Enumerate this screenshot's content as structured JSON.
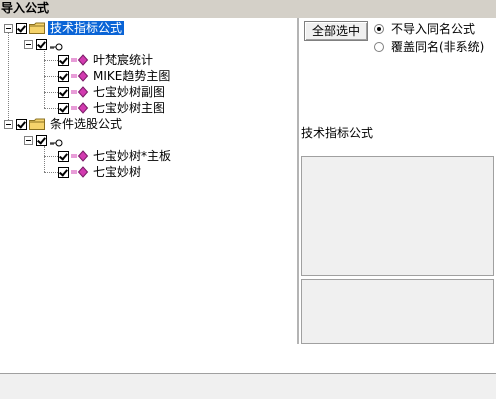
{
  "window": {
    "title": "导入公式"
  },
  "tree": {
    "nodes": [
      {
        "label": "技术指标公式",
        "checked": true,
        "selected": true,
        "icon": "folder-icon"
      },
      {
        "label": "",
        "checked": true,
        "icon": "key-icon"
      },
      {
        "label": "叶梵宸统计",
        "checked": true,
        "icon": "formula-icon"
      },
      {
        "label": "MIKE趋势主图",
        "checked": true,
        "icon": "formula-icon"
      },
      {
        "label": "七宝妙树副图",
        "checked": true,
        "icon": "formula-icon"
      },
      {
        "label": "七宝妙树主图",
        "checked": true,
        "icon": "formula-icon"
      },
      {
        "label": "条件选股公式",
        "checked": true,
        "icon": "folder-icon"
      },
      {
        "label": "",
        "checked": true,
        "icon": "key-icon"
      },
      {
        "label": "七宝妙树*主板",
        "checked": true,
        "icon": "formula-icon"
      },
      {
        "label": "七宝妙树",
        "checked": true,
        "icon": "formula-icon"
      }
    ]
  },
  "options": {
    "select_all_label": "全部选中",
    "radio_no_import": "不导入同名公式",
    "radio_overwrite": "覆盖同名(非系统)",
    "selected_radio": "no_import"
  },
  "detail": {
    "category_label": "技术指标公式"
  },
  "colors": {
    "selection": "#0a64d6",
    "folder": "#f5d36b",
    "formula_diamond": "#d23bb0",
    "chrome": "#d4d0c8"
  }
}
